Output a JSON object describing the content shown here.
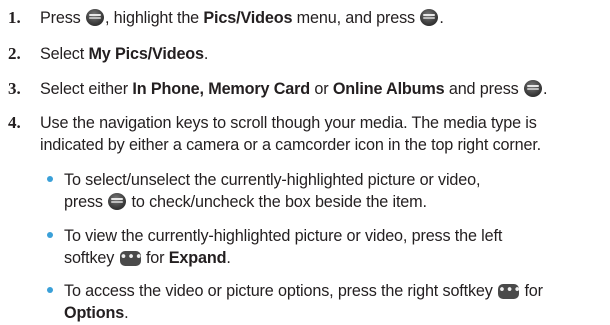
{
  "steps": [
    {
      "num": "1.",
      "a": "Press ",
      "b": ", highlight the ",
      "c": "Pics/Videos",
      "d": " menu, and press ",
      "e": "."
    },
    {
      "num": "2.",
      "a": "Select ",
      "b": "My Pics/Videos",
      "c": "."
    },
    {
      "num": "3.",
      "a": "Select either ",
      "b": "In Phone, Memory Card",
      "c": " or ",
      "d": "Online Albums",
      "e": " and press ",
      "f": "."
    },
    {
      "num": "4.",
      "line1": "Use the navigation keys to scroll though your media. The media type is",
      "line2": "indicated by either a camera or a camcorder icon in the top right corner."
    }
  ],
  "bullets": [
    {
      "line1": "To select/unselect the currently-highlighted picture or video,",
      "a": "press ",
      "b": " to check/uncheck the box beside the item."
    },
    {
      "line1": "To view the currently-highlighted picture or video, press the left",
      "a": "softkey ",
      "b": " for ",
      "c": "Expand",
      "d": "."
    },
    {
      "line1a": "To access the video or picture options, press the right softkey ",
      "line1b": " for",
      "bold": "Options",
      "end": "."
    }
  ],
  "icons": {
    "menu_ok_key": "menu-ok-key-icon",
    "softkey": "softkey-icon"
  },
  "colors": {
    "text": "#231f20",
    "bullet": "#3aa0d8"
  }
}
